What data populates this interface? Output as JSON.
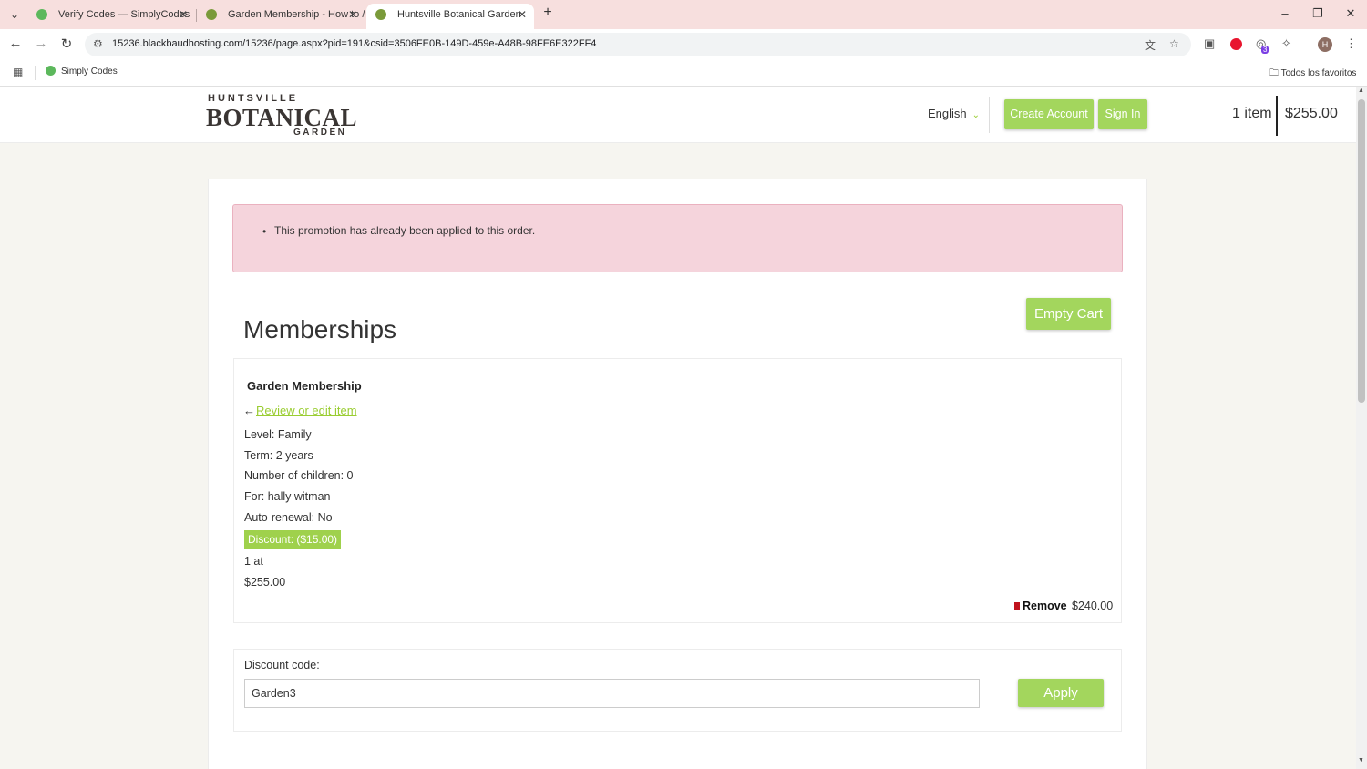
{
  "browser": {
    "tabs": [
      {
        "title": "Verify Codes — SimplyCodes",
        "active": false
      },
      {
        "title": "Garden Membership - How to /",
        "active": false
      },
      {
        "title": "Huntsville Botanical Garden",
        "active": true
      }
    ],
    "url": "15236.blackbaudhosting.com/15236/page.aspx?pid=191&csid=3506FE0B-149D-459e-A48B-98FE6E322FF4",
    "extension_badge": "3",
    "profile_initial": "H",
    "bookmarks": [
      {
        "label": "Simply Codes"
      }
    ],
    "all_bookmarks_label": "Todos los favoritos"
  },
  "header": {
    "logo": {
      "top": "HUNTSVILLE",
      "middle": "BOTANICAL",
      "bottom": "GARDEN"
    },
    "language": "English",
    "create_account_label": "Create Account",
    "sign_in_label": "Sign In",
    "cart_count": "1 item",
    "cart_total": "$255.00"
  },
  "alert": {
    "message": "This promotion has already been applied to this order."
  },
  "main": {
    "heading": "Memberships",
    "empty_cart_label": "Empty Cart",
    "item": {
      "name": "Garden Membership",
      "review_link": "Review or edit item",
      "details": [
        "Level: Family",
        "Term: 2 years",
        "Number of children: 0",
        "For: hally witman",
        "Auto-renewal: No"
      ],
      "discount": "Discount: ($15.00)",
      "quantity_text": "1 at",
      "unit_price": "$255.00",
      "remove_label": "Remove",
      "line_total": "$240.00"
    },
    "discount_code": {
      "label": "Discount code:",
      "value": "Garden3",
      "apply_label": "Apply"
    }
  },
  "colors": {
    "accent_green": "#a3d65d",
    "alert_bg": "#f5d4dc",
    "tabbar_bg": "#f7dfde"
  }
}
